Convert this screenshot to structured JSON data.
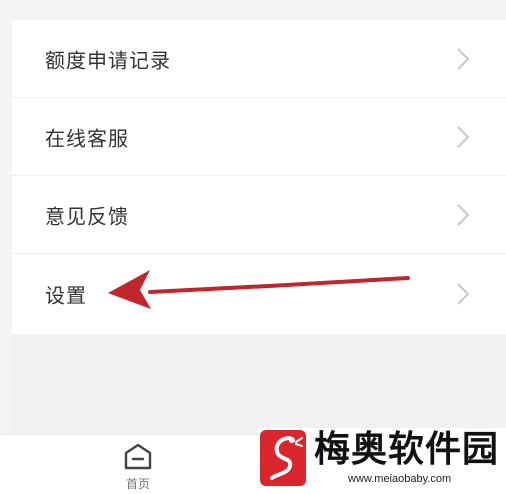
{
  "menu": {
    "items": [
      {
        "label": "额度申请记录"
      },
      {
        "label": "在线客服"
      },
      {
        "label": "意见反馈"
      },
      {
        "label": "设置"
      }
    ]
  },
  "tabbar": {
    "home_label": "首页"
  },
  "watermark": {
    "title": "梅奥软件园",
    "url": "www.meiaobaby.com"
  },
  "annotation": {
    "arrow_color": "#c0262c"
  }
}
